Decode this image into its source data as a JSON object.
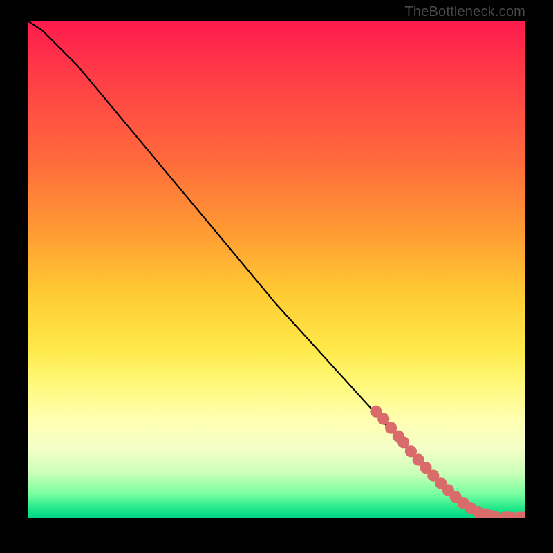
{
  "watermark": "TheBottleneck.com",
  "chart_data": {
    "type": "line",
    "title": "",
    "xlabel": "",
    "ylabel": "",
    "xlim": [
      0,
      100
    ],
    "ylim": [
      0,
      100
    ],
    "grid": false,
    "legend": false,
    "series": [
      {
        "name": "curve",
        "x": [
          0,
          3,
          6,
          10,
          20,
          30,
          40,
          50,
          60,
          70,
          78,
          84,
          88,
          92,
          96,
          100
        ],
        "y": [
          100,
          98,
          95,
          91,
          79,
          67,
          55,
          43,
          32,
          21,
          12,
          6,
          3,
          1,
          0.4,
          0.3
        ]
      }
    ],
    "scatter": {
      "name": "markers",
      "color": "#d96b6b",
      "radius_percent": 1.2,
      "points": [
        {
          "x": 70,
          "y": 21.5
        },
        {
          "x": 71.5,
          "y": 20
        },
        {
          "x": 73,
          "y": 18.2
        },
        {
          "x": 74.5,
          "y": 16.5
        },
        {
          "x": 75.5,
          "y": 15.3
        },
        {
          "x": 77,
          "y": 13.5
        },
        {
          "x": 78.5,
          "y": 11.8
        },
        {
          "x": 80,
          "y": 10.2
        },
        {
          "x": 81.5,
          "y": 8.6
        },
        {
          "x": 83,
          "y": 7.1
        },
        {
          "x": 84.5,
          "y": 5.7
        },
        {
          "x": 86,
          "y": 4.3
        },
        {
          "x": 87.5,
          "y": 3.1
        },
        {
          "x": 89,
          "y": 2.1
        },
        {
          "x": 90.5,
          "y": 1.3
        },
        {
          "x": 92,
          "y": 0.8
        },
        {
          "x": 93,
          "y": 0.5
        },
        {
          "x": 94,
          "y": 0.35
        },
        {
          "x": 96,
          "y": 0.3
        },
        {
          "x": 97,
          "y": 0.3
        },
        {
          "x": 99,
          "y": 0.3
        },
        {
          "x": 100,
          "y": 0.3
        }
      ]
    }
  }
}
